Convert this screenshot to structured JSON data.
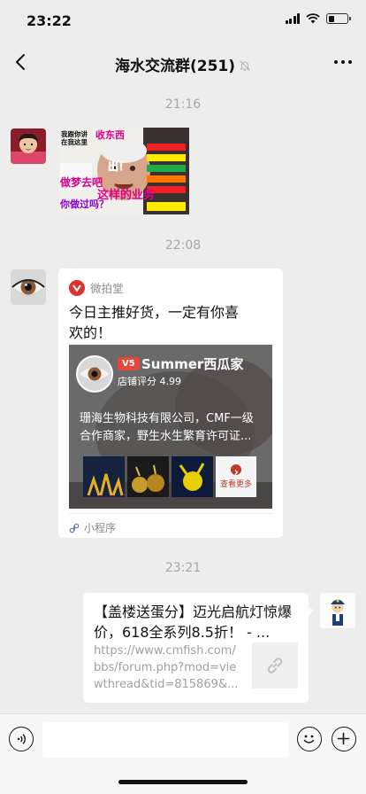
{
  "status_bar": {
    "time": "23:22"
  },
  "header": {
    "title": "海水交流群(251)"
  },
  "messages": {
    "timestamps": [
      "21:16",
      "22:08",
      "23:21"
    ],
    "sticker": {
      "text_lines": [
        "我跟你讲",
        "在我这里",
        "收东西",
        "出！",
        "做梦去吧",
        "这样的业务",
        "你做过吗？"
      ]
    },
    "mini_program": {
      "source": "微拍堂",
      "title": "今日主推好货，一定有你喜欢的！",
      "shop_badge": "V5",
      "shop_name": "Summer西瓜家",
      "shop_rating": "店铺评分 4.99",
      "shop_desc": "珊海生物科技有限公司，CMF一级合作商家，野生水生繁育许可证...",
      "see_more": "查看更多",
      "footer": "小程序"
    },
    "link": {
      "title": "【盖楼送蛋分】迈光启航灯惊爆价，618全系列8.5折！ - ...",
      "url": "https://www.cmfish.com/bbs/forum.php?mod=viewthread&tid=815869&..."
    }
  },
  "input_bar": {
    "placeholder": ""
  },
  "colors": {
    "background": "#ededed",
    "bubble": "#ffffff",
    "timestamp": "#a8a8a8",
    "accent_red": "#d9332b"
  }
}
